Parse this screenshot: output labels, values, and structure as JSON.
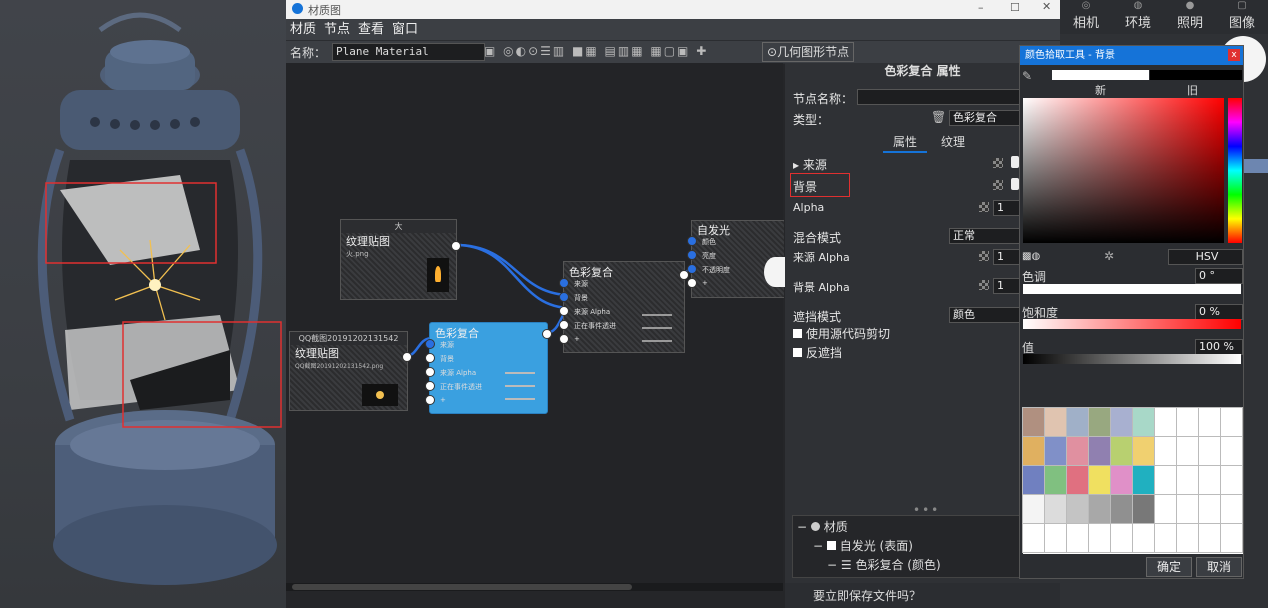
{
  "render_toolbar": {
    "items": [
      {
        "label": "相机",
        "icon": "camera-icon"
      },
      {
        "label": "环境",
        "icon": "globe-icon"
      },
      {
        "label": "照明",
        "icon": "bulb-icon"
      },
      {
        "label": "图像",
        "icon": "image-icon"
      }
    ]
  },
  "material_window": {
    "title": "材质图",
    "menu": [
      "材质",
      "节点",
      "查看",
      "窗口"
    ],
    "toolbar": {
      "name_label": "名称：",
      "name_value": "Plane Material",
      "geometry_node_button": "几何图形节点"
    }
  },
  "nodes": [
    {
      "id": "texture1",
      "header": "大",
      "title": "纹理贴图",
      "sub": "火.png"
    },
    {
      "id": "texture2",
      "header": "QQ截图20191202131542",
      "title": "纹理贴图",
      "sub": "QQ截图20191202131542.png"
    },
    {
      "id": "color1",
      "title": "色彩复合",
      "ports": [
        "来源",
        "背景",
        "来源 Alpha",
        "正在事件透进",
        "+"
      ]
    },
    {
      "id": "color2",
      "title": "色彩复合",
      "ports": [
        "来源",
        "背景",
        "来源 Alpha",
        "正在事件透进",
        "+"
      ]
    },
    {
      "id": "emissive",
      "title": "自发光",
      "ports": [
        "颜色",
        "亮度",
        "不透明度",
        "+"
      ]
    }
  ],
  "props": {
    "header": "色彩复合 属性",
    "node_name_label": "节点名称：",
    "type_label": "类型：",
    "type_value": "色彩复合",
    "tabs": [
      "属性",
      "纹理"
    ],
    "source_label": "来源",
    "background_label": "背景",
    "alpha_label": "Alpha",
    "alpha_value": "1",
    "blend_mode_label": "混合模式",
    "blend_mode_value": "正常",
    "source_alpha_label": "来源 Alpha",
    "source_alpha_value": "1",
    "bg_alpha_label": "背景 Alpha",
    "bg_alpha_value": "1",
    "mask_mode_label": "遮挡模式",
    "mask_mode_value": "颜色",
    "clip_label": "使用源代码剪切",
    "invert_label": "反遮挡",
    "tree": [
      "材质",
      "自发光 (表面)",
      "色彩复合 (颜色)"
    ],
    "save_prompt": "要立即保存文件吗？"
  },
  "picker": {
    "title": "颜色拾取工具 - 背景",
    "new_label": "新",
    "old_label": "旧",
    "mode": "HSV",
    "hue_label": "色调",
    "hue_value": "0 °",
    "sat_label": "饱和度",
    "sat_value": "0 %",
    "val_label": "值",
    "val_value": "100 %",
    "ok": "确定",
    "cancel": "取消",
    "swatches": [
      "#b09080",
      "#e0c4b0",
      "#a0b0c8",
      "#98a880",
      "#a8b0d0",
      "#a8d8c8",
      "#e0b060",
      "#8090c8",
      "#e090a0",
      "#9080b0",
      "#b8d070",
      "#f0d070",
      "#7080c0",
      "#80c080",
      "#e07080",
      "#f0e060",
      "#e090c8",
      "#20b0c0",
      "#f4f4f4",
      "#dcdcdc",
      "#c4c4c4",
      "#a8a8a8",
      "#909090",
      "#787878"
    ]
  },
  "colors": {
    "accent": "#1573d8",
    "node_selected": "#3aa0e0",
    "highlight_box": "#e03030"
  }
}
